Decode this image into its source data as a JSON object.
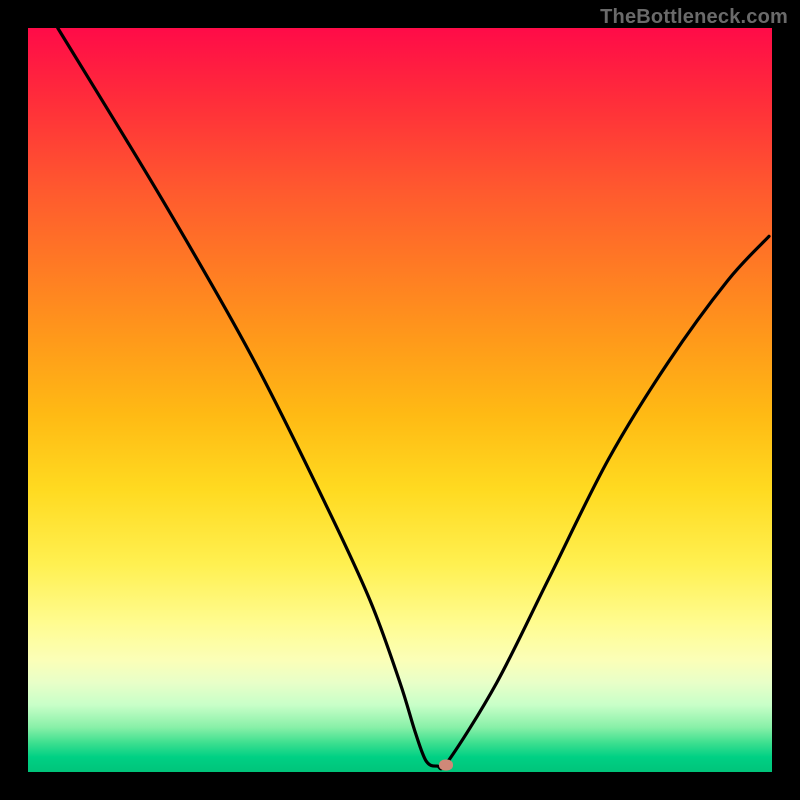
{
  "watermark": "TheBottleneck.com",
  "chart_data": {
    "type": "line",
    "title": "",
    "xlabel": "",
    "ylabel": "",
    "xlim": [
      0,
      100
    ],
    "ylim": [
      0,
      100
    ],
    "x": [
      4,
      18,
      30,
      40,
      46,
      50,
      52,
      53.5,
      55,
      56.5,
      63,
      70,
      78,
      86,
      94,
      99.6
    ],
    "values": [
      100,
      77,
      56,
      36,
      23,
      12,
      5.5,
      1.5,
      0.8,
      1.5,
      12,
      26,
      42,
      55,
      66,
      72
    ],
    "marker": {
      "x": 56.2,
      "y": 0.9
    },
    "gradient_stops": [
      {
        "pos": 0,
        "color": "#ff0b48"
      },
      {
        "pos": 50,
        "color": "#ffba14"
      },
      {
        "pos": 80,
        "color": "#fffc90"
      },
      {
        "pos": 100,
        "color": "#00c47a"
      }
    ]
  }
}
